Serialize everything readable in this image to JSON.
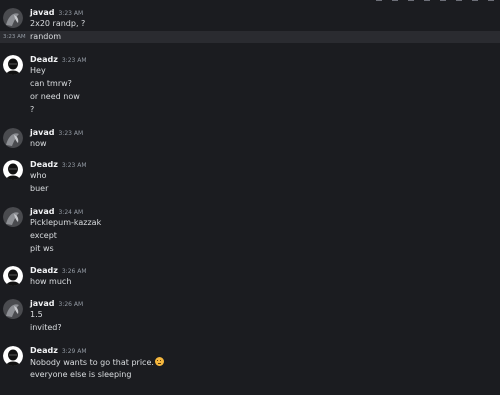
{
  "users": {
    "javad": "javad",
    "deadz": "Deadz"
  },
  "messages": [
    {
      "author": "javad",
      "time": "3:23 AM",
      "lines": [
        "2x20 randp, ?"
      ]
    },
    {
      "side_time": "3:23 AM",
      "lines": [
        "random"
      ]
    },
    {
      "author": "Deadz",
      "time": "3:23 AM",
      "lines": [
        "Hey",
        "can tmrw?",
        "or need now",
        "?"
      ]
    },
    {
      "author": "javad",
      "time": "3:23 AM",
      "lines": [
        "now"
      ]
    },
    {
      "author": "Deadz",
      "time": "3:23 AM",
      "lines": [
        "who",
        "buer"
      ]
    },
    {
      "author": "javad",
      "time": "3:24 AM",
      "lines": [
        "Picklepum-kazzak",
        "except",
        "pit ws"
      ]
    },
    {
      "author": "Deadz",
      "time": "3:26 AM",
      "lines": [
        "how much"
      ]
    },
    {
      "author": "javad",
      "time": "3:26 AM",
      "lines": [
        "1.5",
        "invited?"
      ]
    },
    {
      "author": "Deadz",
      "time": "3:29 AM",
      "lines": [
        "Nobody wants to go that price.",
        "everyone else is sleeping"
      ],
      "emoji": "slightly-frowning-face-emoji"
    }
  ],
  "colors": {
    "background": "#1b1c20",
    "hover_row": "#2a2b30",
    "username": "#f2f3f5",
    "text": "#dbdee1",
    "timestamp": "#949ba4"
  }
}
